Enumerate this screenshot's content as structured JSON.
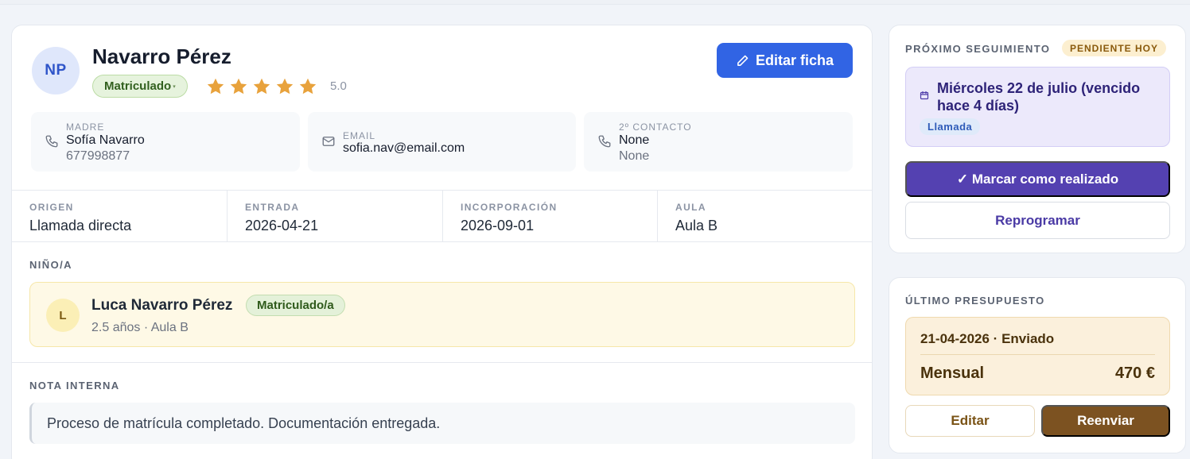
{
  "profile": {
    "initials": "NP",
    "name": "Navarro Pérez",
    "status": "Matriculado",
    "rating": "5.0",
    "stars": 5,
    "edit_label": "Editar ficha"
  },
  "contacts": [
    {
      "label": "MADRE",
      "value": "Sofía Navarro",
      "secondary": "677998877",
      "icon": "phone-icon"
    },
    {
      "label": "EMAIL",
      "value": "sofia.nav@email.com",
      "icon": "mail-icon"
    },
    {
      "label": "2º CONTACTO",
      "value": "None",
      "secondary": "None",
      "icon": "phone-icon"
    }
  ],
  "info": [
    {
      "label": "ORIGEN",
      "value": "Llamada directa"
    },
    {
      "label": "ENTRADA",
      "value": "2026-04-21"
    },
    {
      "label": "INCORPORACIÓN",
      "value": "2026-09-01"
    },
    {
      "label": "AULA",
      "value": "Aula B"
    }
  ],
  "child_section": {
    "title": "NIÑO/A",
    "initial": "L",
    "name": "Luca Navarro Pérez",
    "status": "Matriculado/a",
    "details": "2.5 años · Aula B"
  },
  "note_section": {
    "title": "NOTA INTERNA",
    "text": "Proceso de matrícula completado. Documentación entregada."
  },
  "followup": {
    "title": "PRÓXIMO SEGUIMIENTO",
    "badge": "PENDIENTE HOY",
    "date_text": "Miércoles 22 de julio (vencido hace 4 días)",
    "type": "Llamada",
    "done_label": "✓ Marcar como realizado",
    "reschedule_label": "Reprogramar"
  },
  "budget": {
    "title": "ÚLTIMO PRESUPUESTO",
    "header": "21-04-2026 · Enviado",
    "period": "Mensual",
    "amount": "470 €",
    "edit_label": "Editar",
    "resend_label": "Reenviar"
  },
  "colors": {
    "primary_blue": "#3164e4",
    "purple": "#5441b1",
    "brown": "#7c5221",
    "star": "#e8a23c"
  }
}
